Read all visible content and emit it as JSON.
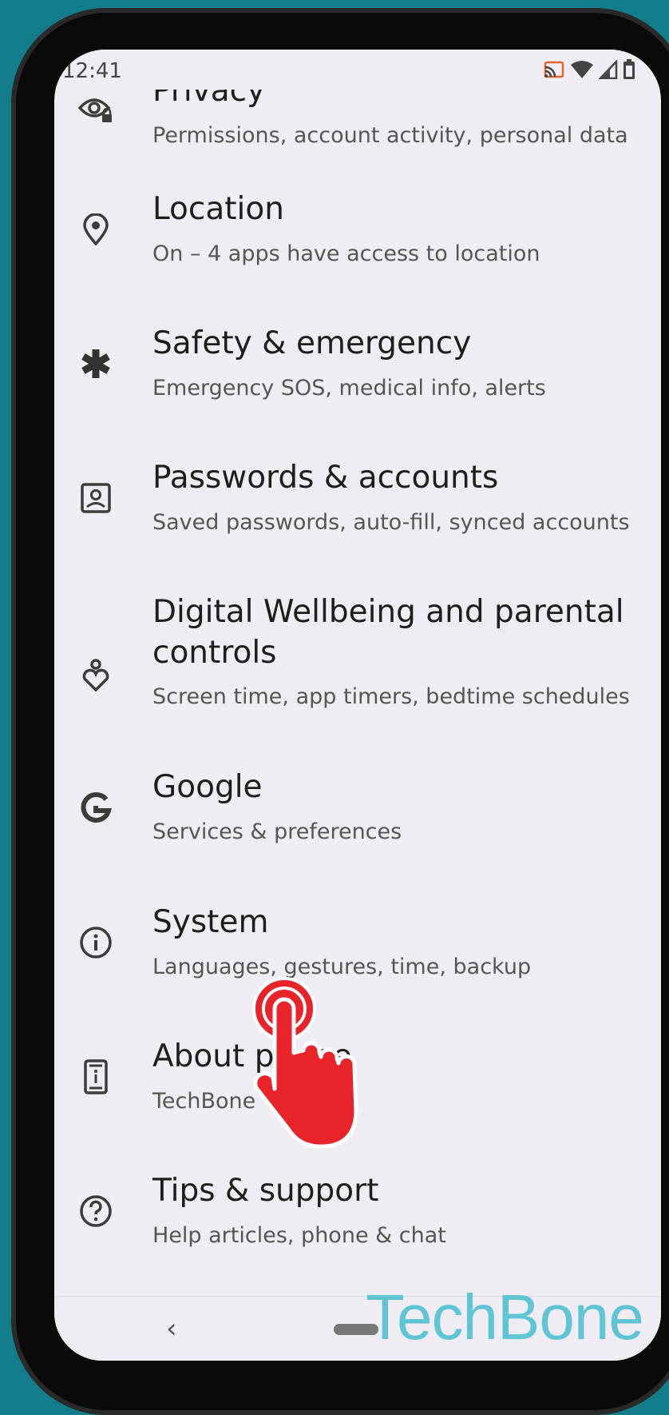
{
  "status_bar": {
    "time": "12:41",
    "icons": [
      "cast-icon",
      "wifi-icon",
      "signal-icon",
      "battery-icon"
    ]
  },
  "settings": [
    {
      "icon": "privacy-eye-lock-icon",
      "title": "Privacy",
      "subtitle": "Permissions, account activity, personal data"
    },
    {
      "icon": "location-pin-icon",
      "title": "Location",
      "subtitle": "On – 4 apps have access to location"
    },
    {
      "icon": "asterisk-emergency-icon",
      "title": "Safety & emergency",
      "subtitle": "Emergency SOS, medical info, alerts"
    },
    {
      "icon": "account-box-icon",
      "title": "Passwords & accounts",
      "subtitle": "Saved passwords, auto-fill, synced accounts"
    },
    {
      "icon": "wellbeing-icon",
      "title": "Digital Wellbeing and parental",
      "title_line2": "controls",
      "subtitle": "Screen time, app timers, bedtime schedules"
    },
    {
      "icon": "google-g-icon",
      "title": "Google",
      "subtitle": "Services & preferences"
    },
    {
      "icon": "info-icon",
      "title": "System",
      "subtitle": "Languages, gestures, time, backup"
    },
    {
      "icon": "phone-info-icon",
      "title": "About phone",
      "subtitle": "TechBone"
    },
    {
      "icon": "help-icon",
      "title": "Tips & support",
      "subtitle": "Help articles, phone & chat"
    }
  ],
  "nav_bar": {
    "back": "‹"
  },
  "watermark": "TechBone",
  "colors": {
    "frame": "#147d8c",
    "screen": "#efedf3",
    "tap_indicator": "#e8232a",
    "watermark": "#5fc4d3"
  }
}
